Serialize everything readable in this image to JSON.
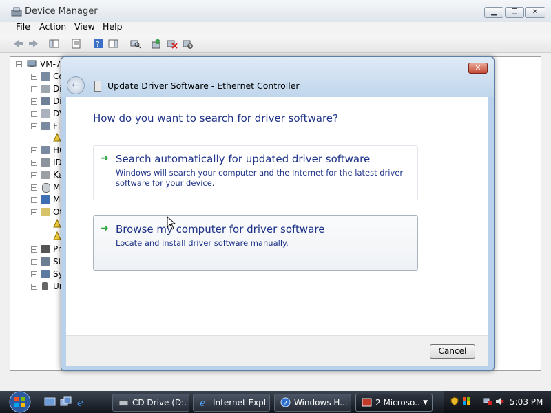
{
  "window": {
    "title": "Device Manager",
    "menu": [
      "File",
      "Action",
      "View",
      "Help"
    ]
  },
  "tree": {
    "root": "VM-7",
    "items": [
      "Co",
      "Di",
      "Di",
      "DV",
      "Fl",
      "Hu",
      "ID",
      "Ke",
      "M",
      "M",
      "Ot",
      "Pr",
      "St",
      "Sy",
      "Ur"
    ]
  },
  "dialog": {
    "title": "Update Driver Software - Ethernet Controller",
    "question": "How do you want to search for driver software?",
    "options": [
      {
        "title": "Search automatically for updated driver software",
        "description": "Windows will search your computer and the Internet for the latest driver software for your device."
      },
      {
        "title": "Browse my computer for driver software",
        "description": "Locate and install driver software manually."
      }
    ],
    "cancel_label": "Cancel",
    "close_glyph": "✕"
  },
  "taskbar": {
    "tasks": [
      {
        "label": "CD Drive (D:..."
      },
      {
        "label": "Internet Expl..."
      },
      {
        "label": "Windows H..."
      },
      {
        "label": "2 Microso..."
      }
    ],
    "clock": "5:03 PM"
  },
  "colors": {
    "link_blue": "#1e3287",
    "arrow_green": "#2ba23a"
  }
}
